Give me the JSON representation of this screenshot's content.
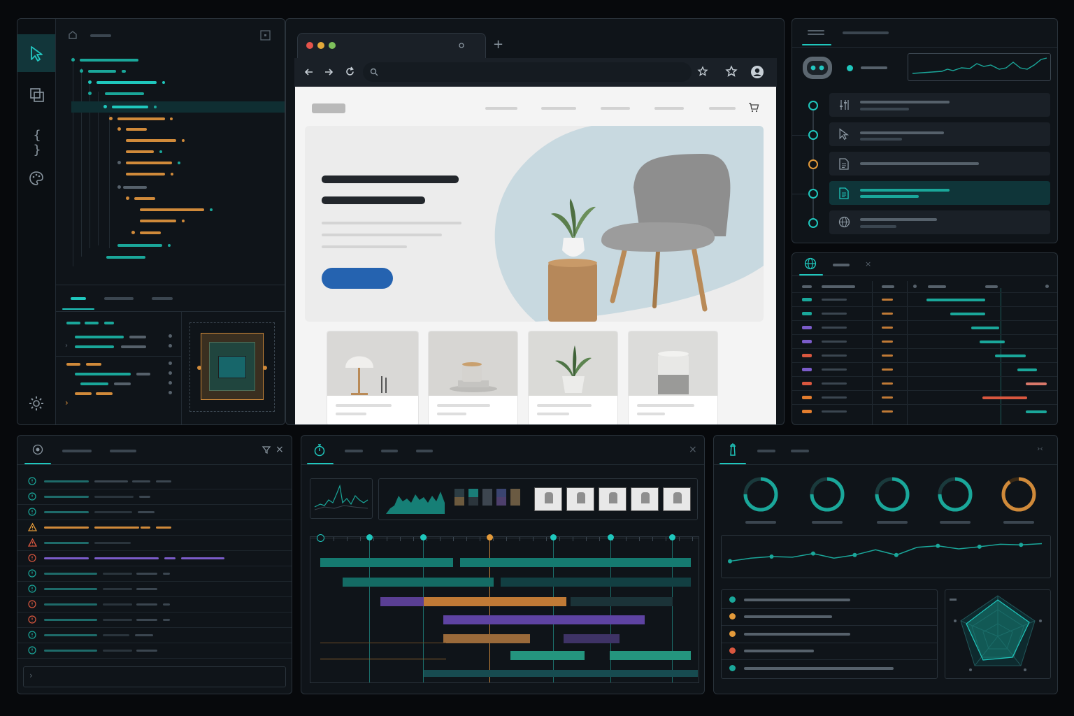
{
  "icons": {
    "select_tool": "cursor-icon",
    "layers": "layers-icon",
    "code": "braces-icon",
    "palette": "palette-icon",
    "settings": "gear-icon",
    "agent": "robot-icon",
    "network": "globe-icon",
    "console": "target-icon",
    "performance": "stopwatch-icon",
    "lighthouse": "lighthouse-icon"
  },
  "browser": {
    "braces_glyph": "{ }",
    "new_tab_glyph": "+"
  },
  "colors": {
    "teal": "#1aa79a",
    "orange": "#d08a3a",
    "purple": "#7b5cc9",
    "red": "#d9573f",
    "hero_button": "#2563b0",
    "page_bg": "#07090c"
  },
  "metrics": {
    "gauges": [
      0.75,
      0.75,
      0.75,
      0.75,
      0.9
    ]
  },
  "trend": {
    "values": [
      0.35,
      0.45,
      0.5,
      0.48,
      0.6,
      0.45,
      0.55,
      0.72,
      0.55,
      0.8,
      0.85,
      0.75,
      0.82,
      0.9,
      0.88,
      0.92
    ]
  }
}
